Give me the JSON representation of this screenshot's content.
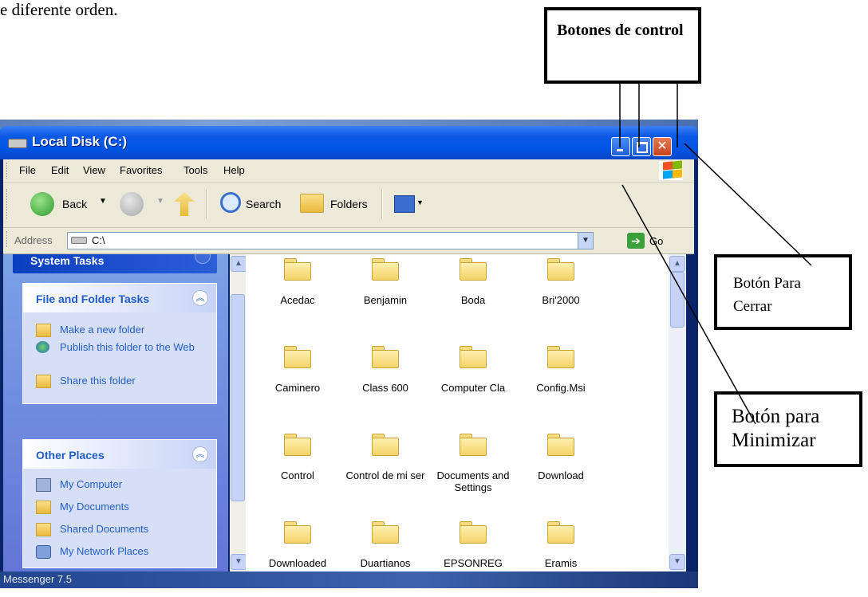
{
  "document": {
    "intro_text": "e diferente orden."
  },
  "callouts": {
    "controls": "Botones de control",
    "close": "Botón Para Cerrar",
    "minimize": "Botón para Minimizar"
  },
  "window": {
    "title": "Local Disk (C:)",
    "menu": [
      "File",
      "Edit",
      "View",
      "Favorites",
      "Tools",
      "Help"
    ],
    "toolbar": {
      "back": "Back",
      "search": "Search",
      "folders": "Folders"
    },
    "address": {
      "label": "Address",
      "value": "C:\\",
      "go": "Go"
    },
    "left_panel": {
      "system_tasks": "System Tasks",
      "file_folder_tasks": {
        "title": "File and Folder Tasks",
        "items": [
          "Make a new folder",
          "Publish this folder to the Web",
          "Share this folder"
        ]
      },
      "other_places": {
        "title": "Other Places",
        "items": [
          "My Computer",
          "My Documents",
          "Shared Documents",
          "My Network Places"
        ]
      }
    },
    "folders": [
      "Acedac",
      "Benjamin",
      "Boda",
      "Bri'2000",
      "Caminero",
      "Class 600",
      "Computer Cla",
      "Config.Msi",
      "Control",
      "Control de mi ser",
      "Documents and Settings",
      "Download",
      "Downloaded",
      "Duartianos",
      "EPSONREG",
      "Eramis"
    ],
    "taskbar_text": "Messenger 7.5"
  },
  "colors": {
    "xp_blue": "#0054e3",
    "close_red": "#c9431c",
    "panel_blue": "#215dc6",
    "folder_yellow": "#f4d368"
  }
}
